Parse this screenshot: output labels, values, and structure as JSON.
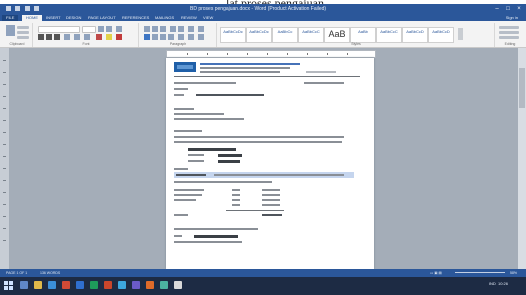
{
  "caption": "lat proses pengajuan",
  "window": {
    "title": "BD proses pengajuan.docx - Word (Product Activation Failed)",
    "controls": [
      "–",
      "□",
      "×"
    ]
  },
  "ribbon": {
    "tabs": [
      "FILE",
      "HOME",
      "INSERT",
      "DESIGN",
      "PAGE LAYOUT",
      "REFERENCES",
      "MAILINGS",
      "REVIEW",
      "VIEW"
    ],
    "active_tab": "HOME",
    "user": "Sign in",
    "groups": [
      "Clipboard",
      "Font",
      "Paragraph",
      "Styles",
      "Editing"
    ],
    "styles": [
      "AaBbCcDc",
      "AaBbCcDc",
      "AaBbCc",
      "AaBbCcC",
      "AaBb",
      "AaBbCcC",
      "AaBbCcD",
      "AaBbCcD"
    ],
    "style_big": "AaB"
  },
  "status": {
    "page": "PAGE 1 OF 1",
    "words": "136 WORDS",
    "zoom": "58%"
  },
  "taskbar": {
    "time": "10:26",
    "lang": "IND"
  }
}
